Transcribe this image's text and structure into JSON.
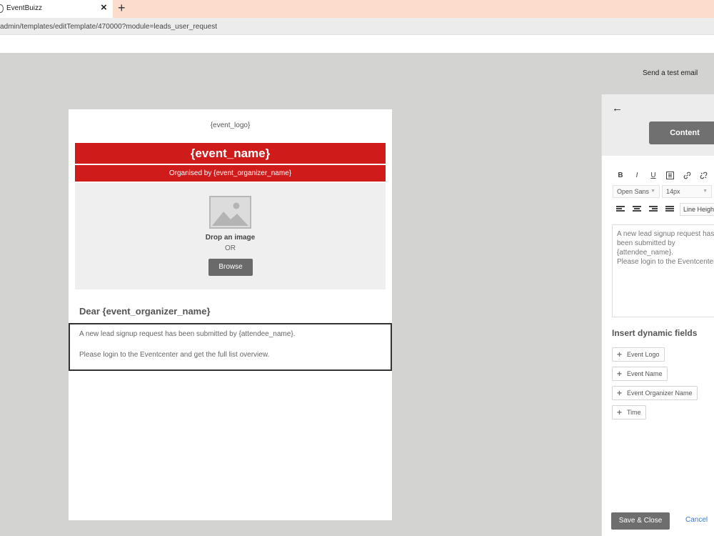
{
  "browser": {
    "tab_title": "EventBuizz",
    "tab_close": "×",
    "new_tab": "+",
    "url": "admin/templates/editTemplate/470000?module=leads_user_request"
  },
  "topbar": {
    "send_test_label": "Send a test email"
  },
  "email": {
    "logo_placeholder": "{event_logo}",
    "event_name": "{event_name}",
    "organiser_line": "Organised by {event_organizer_name}",
    "drop_label": "Drop an image",
    "or_label": "OR",
    "browse_label": "Browse",
    "greeting": "Dear {event_organizer_name}",
    "body_line1": "A new lead signup request has been submitted by {attendee_name}.",
    "body_line2": "Please login to the Eventcenter and get the full list overview."
  },
  "panel": {
    "back_icon": "arrow-left-icon",
    "content_tab_label": "Content",
    "toolbar": {
      "bold": "B",
      "italic": "I",
      "underline": "U"
    },
    "font_family_value": "Open Sans",
    "font_size_value": "14px",
    "line_height_label": "Line Height",
    "editor_text1": "A new lead signup request has been submitted by {attendee_name}.",
    "editor_text2": "Please login to the Eventcenter and get the full list overview.",
    "dynamic_title": "Insert dynamic fields",
    "dynamic_fields": [
      "Event Logo",
      "Event Name",
      "Event Organizer Name",
      "Time"
    ],
    "save_close_label": "Save & Close",
    "cancel_label": "Cancel"
  },
  "colors": {
    "banner_red": "#d01b1b",
    "button_gray": "#6a6a6a",
    "link_blue": "#3a7bd5"
  }
}
